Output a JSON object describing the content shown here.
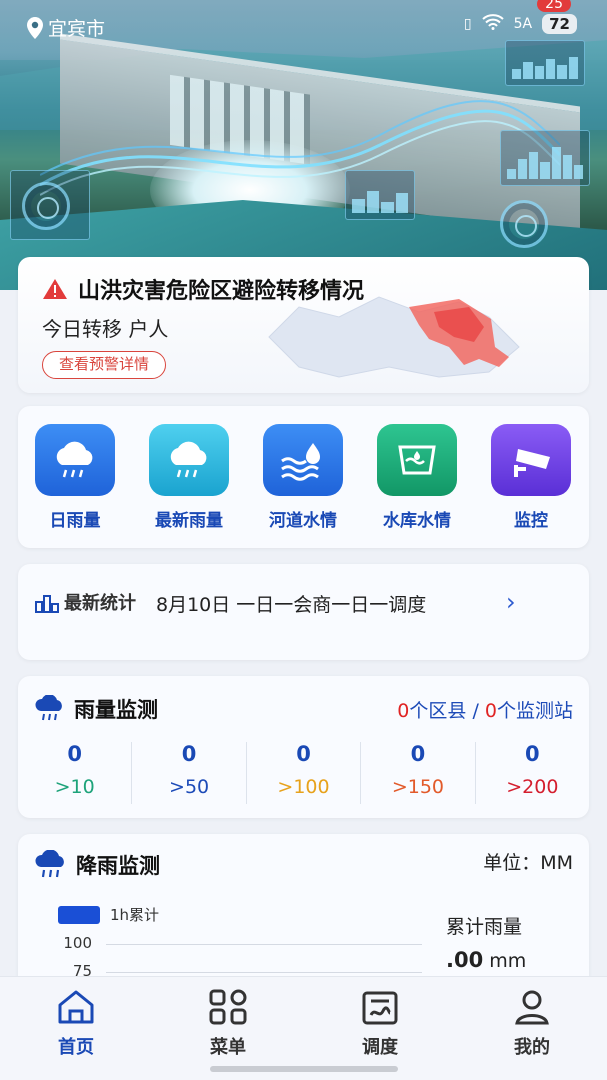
{
  "status_bar": {
    "location": "宜宾市",
    "signal": "5A",
    "battery": "72",
    "notification_count": "25"
  },
  "alert": {
    "title": "山洪灾害危险区避险转移情况",
    "subtitle": "今日转移 户人",
    "button": "查看预警详情"
  },
  "shortcuts": [
    {
      "label": "日雨量",
      "icon": "rain-cloud-icon",
      "color": "#2f7be6"
    },
    {
      "label": "最新雨量",
      "icon": "rain-cloud-icon",
      "color": "#2cb5d9"
    },
    {
      "label": "河道水情",
      "icon": "water-wave-icon",
      "color": "#2e7be8"
    },
    {
      "label": "水库水情",
      "icon": "reservoir-icon",
      "color": "#17a57a"
    },
    {
      "label": "监控",
      "icon": "camera-icon",
      "color": "#6a3fe0"
    }
  ],
  "stats": {
    "label": "最新统计",
    "text": "8月10日 一日一会商一日一调度"
  },
  "rain_monitor": {
    "title": "雨量监测",
    "districts_count": "0",
    "districts_label": "个区县",
    "separator": "/",
    "stations_count": "0",
    "stations_label": "个监测站",
    "columns": [
      {
        "value": "0",
        "threshold": ">10",
        "color": "#1ea37a"
      },
      {
        "value": "0",
        "threshold": ">50",
        "color": "#1d4bb8"
      },
      {
        "value": "0",
        "threshold": ">100",
        "color": "#e7a21c"
      },
      {
        "value": "0",
        "threshold": ">150",
        "color": "#e25a2a"
      },
      {
        "value": "0",
        "threshold": ">200",
        "color": "#d41e2e"
      }
    ]
  },
  "rainfall": {
    "title": "降雨监测",
    "unit": "单位：MM",
    "legend": "1h累计",
    "y_ticks": [
      "100",
      "75"
    ],
    "cumulative_label": "累计雨量",
    "cumulative_value": ".00",
    "cumulative_unit": "mm"
  },
  "nav": [
    {
      "label": "首页",
      "icon": "home-icon",
      "active": true
    },
    {
      "label": "菜单",
      "icon": "grid-menu-icon",
      "active": false
    },
    {
      "label": "调度",
      "icon": "dispatch-icon",
      "active": false
    },
    {
      "label": "我的",
      "icon": "user-icon",
      "active": false
    }
  ]
}
